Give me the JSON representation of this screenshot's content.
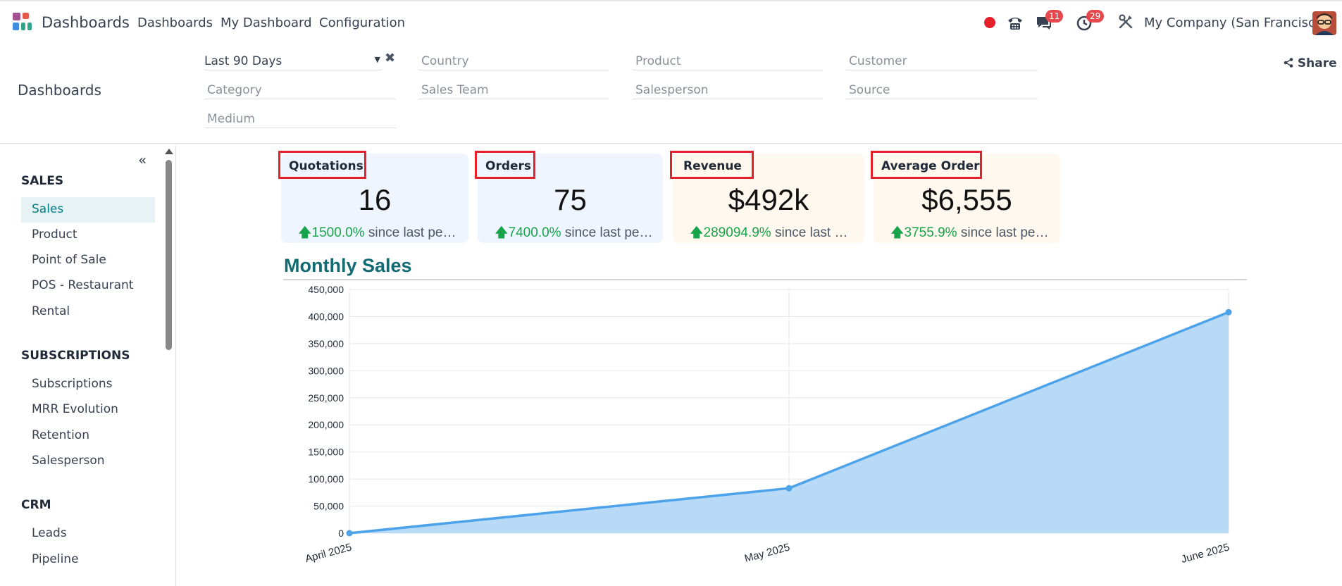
{
  "navbar": {
    "brand": "Dashboards",
    "menu": [
      "Dashboards",
      "My Dashboard",
      "Configuration"
    ],
    "messages_badge": "11",
    "activities_badge": "29",
    "company": "My Company (San Francisco)"
  },
  "filters": {
    "date_range": "Last 90 Days",
    "country": "Country",
    "product": "Product",
    "customer": "Customer",
    "category": "Category",
    "sales_team": "Sales Team",
    "salesperson": "Salesperson",
    "source": "Source",
    "medium": "Medium"
  },
  "page_title": "Dashboards",
  "share_label": "Share",
  "sidebar": {
    "sections": [
      {
        "title": "SALES",
        "items": [
          "Sales",
          "Product",
          "Point of Sale",
          "POS - Restaurant",
          "Rental"
        ]
      },
      {
        "title": "SUBSCRIPTIONS",
        "items": [
          "Subscriptions",
          "MRR Evolution",
          "Retention",
          "Salesperson"
        ]
      },
      {
        "title": "CRM",
        "items": [
          "Leads",
          "Pipeline"
        ]
      }
    ],
    "active_item": "Sales"
  },
  "kpis": [
    {
      "label": "Quotations",
      "value": "16",
      "pct": "1500.0%",
      "suffix": " since last period"
    },
    {
      "label": "Orders",
      "value": "75",
      "pct": "7400.0%",
      "suffix": " since last period"
    },
    {
      "label": "Revenue",
      "value": "$492k",
      "pct": "289094.9%",
      "suffix": " since last period"
    },
    {
      "label": "Average Order",
      "value": "$6,555",
      "pct": "3755.9%",
      "suffix": " since last period"
    }
  ],
  "colors": {
    "accent": "#017e84",
    "kpi_blue": "#eef5ff",
    "kpi_orange": "#fff8ee",
    "positive": "#16a34a",
    "highlight": "#e5202a",
    "series_line": "#4da3ea",
    "series_fill": "#b5d8f6"
  },
  "chart_data": {
    "type": "area",
    "title": "Monthly Sales",
    "categories": [
      "April 2025",
      "May 2025",
      "June 2025"
    ],
    "series": [
      {
        "values": [
          0,
          83000,
          408000
        ]
      }
    ],
    "ylim": [
      0,
      450000
    ],
    "yticks": [
      0,
      50000,
      100000,
      150000,
      200000,
      250000,
      300000,
      350000,
      400000,
      450000
    ],
    "grid": true
  }
}
